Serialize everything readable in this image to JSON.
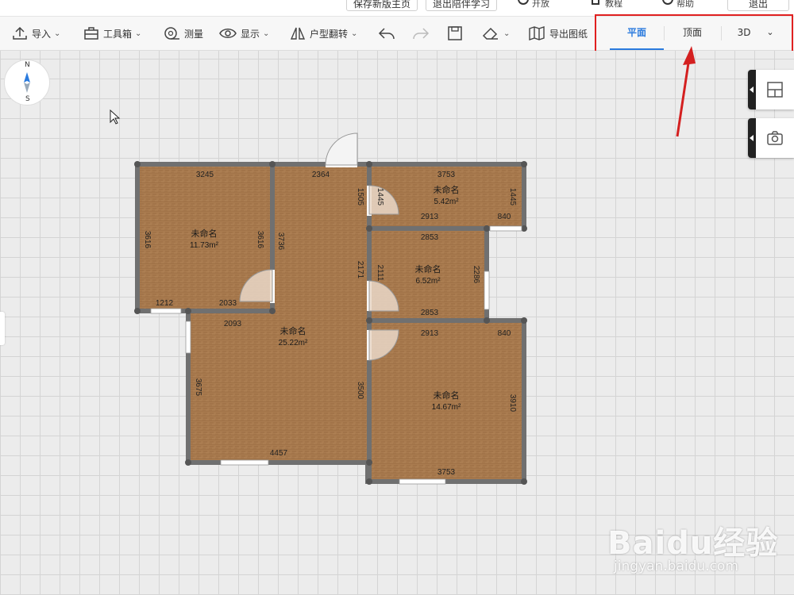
{
  "top_bar": {
    "buttons": [
      "保存新版主页",
      "退出陪伴学习"
    ],
    "menus": [
      "开放",
      "教程",
      "帮助",
      "退出"
    ]
  },
  "toolbar": {
    "import_label": "导入",
    "toolbox_label": "工具箱",
    "measure_label": "测量",
    "display_label": "显示",
    "flip_label": "户型翻转",
    "export_label": "导出图纸"
  },
  "view_tabs": [
    "平面",
    "顶面",
    "3D"
  ],
  "active_view": "平面",
  "compass": {
    "north": "N",
    "south": "S"
  },
  "rooms": [
    {
      "name": "未命名",
      "area": "11.73m²"
    },
    {
      "name": "未命名",
      "area": "25.22m²"
    },
    {
      "name": "未命名",
      "area": "5.42m²"
    },
    {
      "name": "未命名",
      "area": "6.52m²"
    },
    {
      "name": "未命名",
      "area": "14.67m²"
    }
  ],
  "dimensions": [
    "3245",
    "2364",
    "3753",
    "3616",
    "3616",
    "3736",
    "1505",
    "1445",
    "1445",
    "2913",
    "840",
    "2853",
    "2171",
    "2111",
    "2286",
    "1212",
    "2033",
    "2093",
    "2853",
    "2913",
    "840",
    "3675",
    "3500",
    "3910",
    "4457",
    "3753"
  ],
  "watermark": {
    "logo": "Baidu经验",
    "url": "jingyan.baidu.com"
  },
  "colors": {
    "accent": "#2b7bde",
    "highlight": "#e02020",
    "wall": "#6e6e6e",
    "floor": "#a97b4f"
  }
}
